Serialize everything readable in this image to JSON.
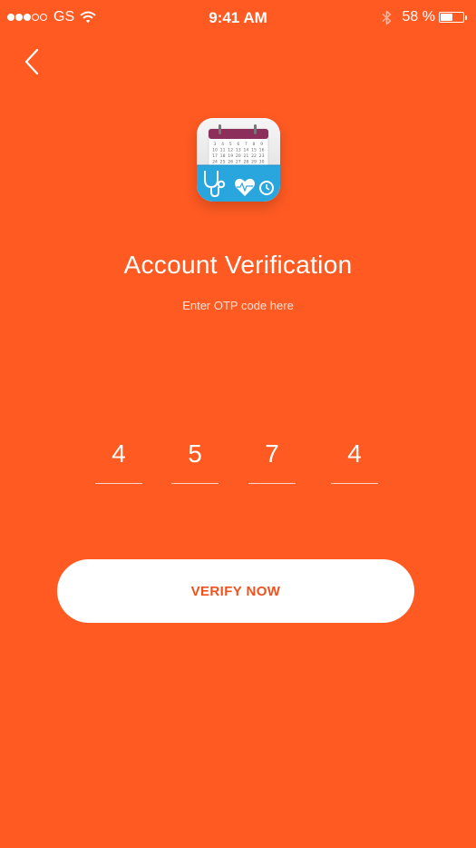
{
  "status_bar": {
    "carrier": "GS",
    "signal_bars_filled": 3,
    "signal_bars_total": 5,
    "time": "9:41 AM",
    "battery_percent_label": "58 %",
    "battery_level": 0.58,
    "icons": [
      "signal-dots-icon",
      "wifi-icon",
      "bluetooth-icon",
      "battery-icon"
    ]
  },
  "nav": {
    "back_icon": "chevron-left-icon"
  },
  "app_icon": {
    "name": "calendar-medical-app-icon",
    "calendar_rows": [
      [
        "3",
        "4",
        "5",
        "6",
        "7",
        "8",
        "9"
      ],
      [
        "10",
        "11",
        "12",
        "13",
        "14",
        "15",
        "16"
      ],
      [
        "17",
        "18",
        "19",
        "20",
        "21",
        "22",
        "23"
      ],
      [
        "24",
        "25",
        "26",
        "27",
        "28",
        "29",
        "30"
      ]
    ]
  },
  "page": {
    "title": "Account Verification",
    "subtitle": "Enter OTP code here"
  },
  "otp": {
    "digits": [
      "4",
      "5",
      "7",
      "4"
    ]
  },
  "actions": {
    "verify_label": "VERIFY NOW"
  },
  "colors": {
    "background": "#FF5A22",
    "button_bg": "#FFFFFF",
    "button_text": "#F0521D",
    "icon_calendar_header": "#8C2F5A",
    "icon_pocket": "#2AA6DF"
  }
}
